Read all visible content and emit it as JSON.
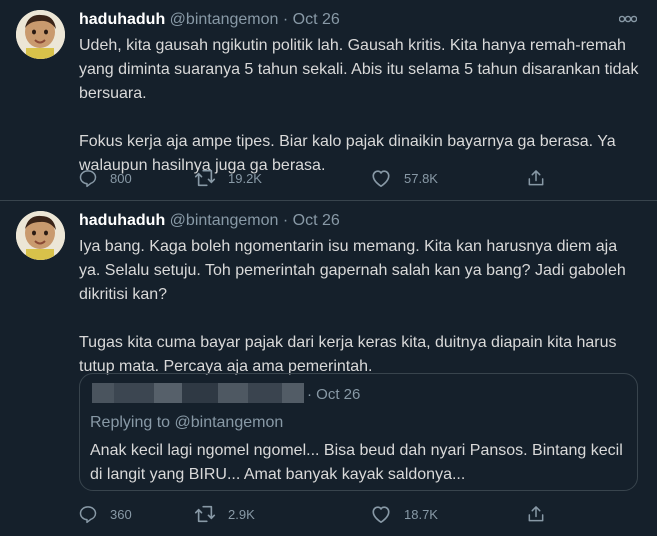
{
  "colors": {
    "background": "#15202b",
    "border": "#38444d",
    "secondary_text": "#8899a6",
    "primary_text": "#d9d9d9",
    "name_text": "#ffffff"
  },
  "tweets": [
    {
      "name": "haduhaduh",
      "handle": "@bintangemon",
      "separator": "·",
      "date": "Oct 26",
      "paragraphs": [
        "Udeh, kita gausah ngikutin politik lah. Gausah kritis. Kita hanya remah-remah yang diminta suaranya 5 tahun sekali. Abis itu selama 5 tahun disarankan tidak bersuara.",
        "Fokus kerja aja ampe tipes. Biar kalo pajak dinaikin bayarnya ga berasa. Ya walaupun hasilnya juga ga berasa."
      ],
      "replies": "800",
      "retweets": "19.2K",
      "likes": "57.8K",
      "icons": [
        "reply-icon",
        "retweet-icon",
        "like-icon",
        "share-icon",
        "more-icon"
      ]
    },
    {
      "name": "haduhaduh",
      "handle": "@bintangemon",
      "separator": "·",
      "date": "Oct 26",
      "paragraphs": [
        "Iya bang. Kaga boleh ngomentarin isu memang. Kita kan harusnya diem aja ya. Selalu setuju. Toh pemerintah gapernah salah kan ya bang? Jadi gaboleh dikritisi kan?",
        "Tugas kita cuma bayar pajak dari kerja keras kita, duitnya diapain kita harus tutup mata. Percaya aja ama pemerintah."
      ],
      "quote": {
        "date": "· Oct 26",
        "replying_to": "Replying to @bintangemon",
        "text": "Anak kecil lagi ngomel ngomel... Bisa beud dah nyari Pansos. Bintang kecil di langit yang BIRU... Amat banyak kayak saldonya..."
      },
      "replies": "360",
      "retweets": "2.9K",
      "likes": "18.7K"
    }
  ]
}
